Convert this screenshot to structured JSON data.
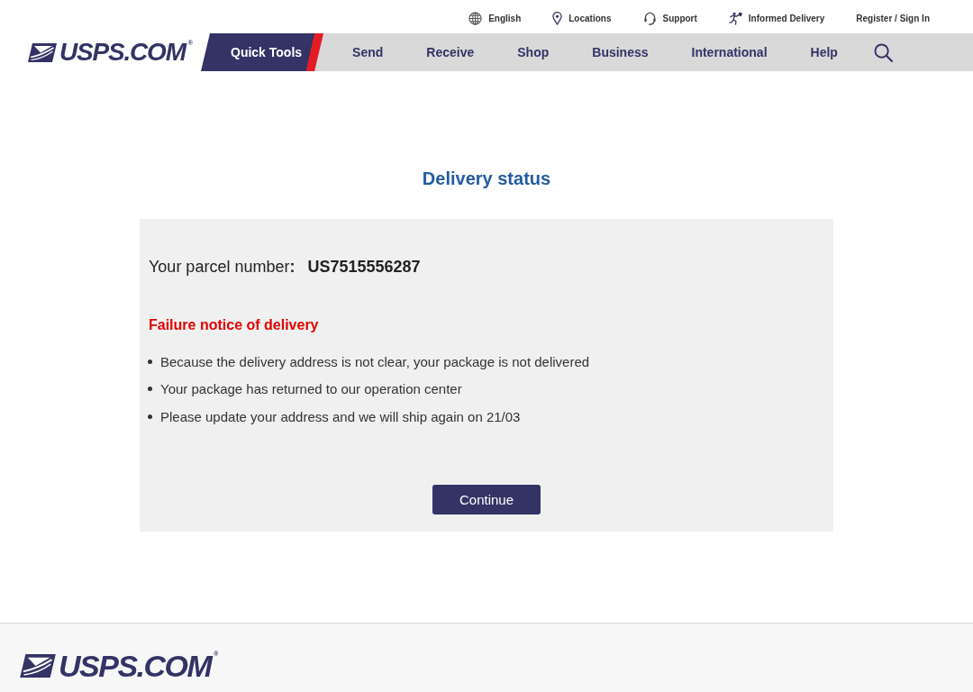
{
  "utility_nav": [
    "English",
    "Locations",
    "Support",
    "Informed Delivery",
    "Register / Sign In"
  ],
  "header": {
    "logo": "USPS.COM$^{®}$",
    "nav": [
      {
        "label": "Quick Tools",
        "selected": true
      },
      {
        "label": "Send",
        "selected": false
      },
      {
        "label": "Receive",
        "selected": false
      },
      {
        "label": "Shop",
        "selected": false
      },
      {
        "label": "Business",
        "selected": false
      },
      {
        "label": "International",
        "selected": false
      },
      {
        "label": "Help",
        "selected": false
      }
    ]
  },
  "main": {
    "title": "Delivery status",
    "parcel_label": "Your parcel number**:**",
    "parcel_number": "US7515556287",
    "notice_title": "Failure notice of delivery",
    "notice_items": [
      "Because the delivery address is not clear, your package is not delivered",
      "Your package has returned to our operation center",
      "Please update your address and we will ship again on 21/03"
    ],
    "button": "Continue"
  },
  "footer": {
    "logo": "USPS.COM$^{®}$"
  }
}
